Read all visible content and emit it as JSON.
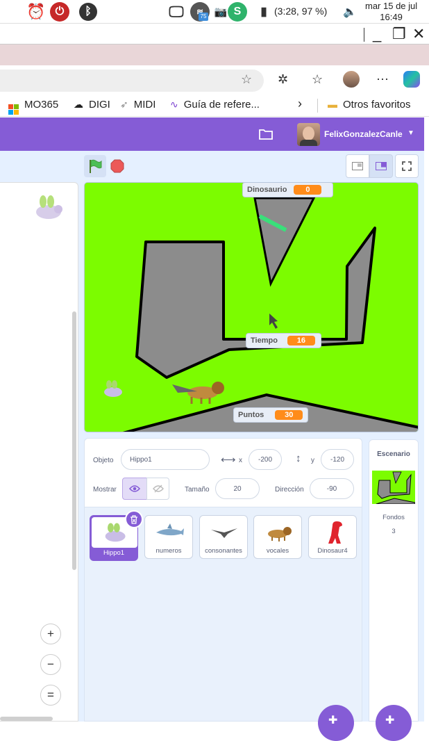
{
  "tray": {
    "time": "(3:28, 97 %)",
    "date": "mar 15 de jul",
    "clock": "16:49",
    "wifi_badge": "75"
  },
  "window": {
    "minimize": "_",
    "maximize": "❐",
    "close": "✕"
  },
  "favorites": [
    {
      "label": "MO365",
      "icon": "ms-grid-icon"
    },
    {
      "label": "DIGI",
      "icon": "cloud-icon"
    },
    {
      "label": "MIDI",
      "icon": "midi-icon"
    },
    {
      "label": "Guía de refere...",
      "icon": "squiggle-icon"
    },
    {
      "label": "Otros favoritos",
      "icon": "folder-icon"
    }
  ],
  "header": {
    "username": "FelixGonzalezCanle"
  },
  "monitors": [
    {
      "name": "Dinosaurio",
      "value": "0"
    },
    {
      "name": "Tiempo",
      "value": "16"
    },
    {
      "name": "Puntos",
      "value": "30"
    }
  ],
  "sprite_info": {
    "object_label": "Objeto",
    "object_value": "Hippo1",
    "x_label": "x",
    "x_value": "-200",
    "y_label": "y",
    "y_value": "-120",
    "show_label": "Mostrar",
    "size_label": "Tamaño",
    "size_value": "20",
    "direction_label": "Dirección",
    "direction_value": "-90"
  },
  "sprites": [
    "Hippo1",
    "numeros",
    "consonantes",
    "vocales",
    "Dinosaur4"
  ],
  "stage_panel": {
    "title": "Escenario",
    "backdrops_label": "Fondos",
    "backdrops_count": "3"
  },
  "zoom": {
    "in": "+",
    "out": "−",
    "reset": "="
  },
  "colors": {
    "scratch_purple": "#855cd6",
    "stage_green": "#7cfc00",
    "monitor_orange": "#ff8c1a"
  }
}
